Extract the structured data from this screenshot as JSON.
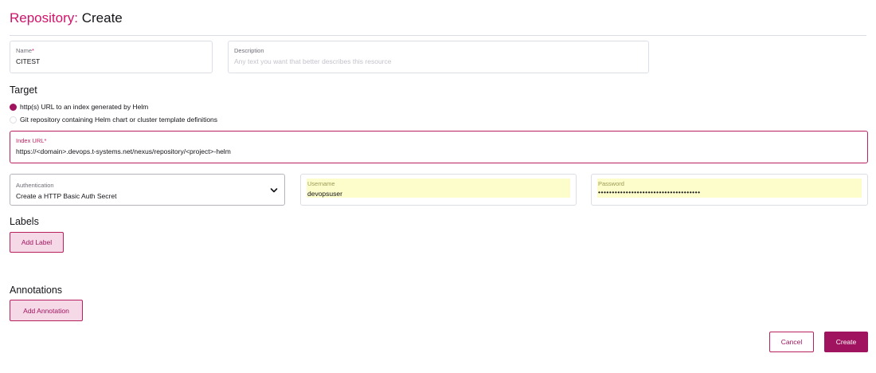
{
  "header": {
    "crumb": "Repository",
    "separator": ":",
    "action": "Create"
  },
  "name_field": {
    "label": "Name",
    "required_mark": "*",
    "value": "CITEST"
  },
  "description_field": {
    "label": "Description",
    "placeholder": "Any text you want that better describes this resource"
  },
  "target": {
    "heading": "Target",
    "options": [
      {
        "label": "http(s) URL to an index generated by Helm",
        "selected": true
      },
      {
        "label": "Git repository containing Helm chart or cluster template definitions",
        "selected": false
      }
    ]
  },
  "index_url_field": {
    "label": "Index URL",
    "required_mark": "*",
    "value": "https://<domain>.devops.t-systems.net/nexus/repository/<project>-helm"
  },
  "authentication": {
    "label": "Authentication",
    "value": "Create a HTTP Basic Auth Secret",
    "icon": "chevron-down-icon"
  },
  "username_field": {
    "label": "Username",
    "value": "devopsuser"
  },
  "password_field": {
    "label": "Password",
    "value": "•••••••••••••••••••••••••••••••••••••"
  },
  "labels": {
    "heading": "Labels",
    "add_button": "Add Label"
  },
  "annotations": {
    "heading": "Annotations",
    "add_button": "Add Annotation"
  },
  "footer": {
    "cancel": "Cancel",
    "create": "Create"
  },
  "colors": {
    "accent": "#a0145f",
    "title_accent": "#d0136a",
    "autofill": "#fdfdcc"
  }
}
